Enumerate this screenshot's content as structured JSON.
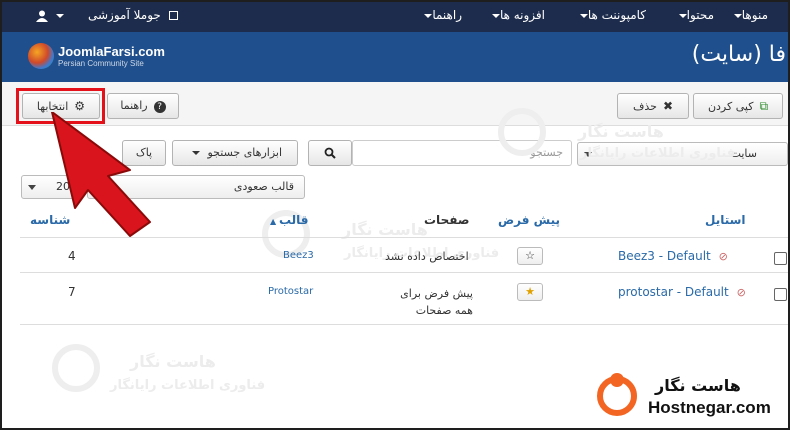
{
  "navbar": {
    "menus": [
      {
        "label": "منوها"
      },
      {
        "label": "محتوا"
      },
      {
        "label": "کامپوننت ها"
      },
      {
        "label": "افزونه ها"
      },
      {
        "label": "راهنما"
      }
    ],
    "site_label": "جوملا آموزشی"
  },
  "header": {
    "logo_text": "JoomlaFarsi.com",
    "logo_sub": "Persian Community Site",
    "title": "فا (سایت)"
  },
  "toolbar": {
    "copy_label": "کپی کردن",
    "delete_label": "حذف",
    "help_label": "راهنما",
    "options_label": "انتخابها"
  },
  "filters": {
    "site_select": "سایت",
    "search_placeholder": "جستجو",
    "search_tools_label": "ابزارهای جستجو",
    "clear_label": "پاک",
    "sort_select": "قالب صعودی",
    "limit_select": "20"
  },
  "table": {
    "headers": {
      "style": "استایل",
      "default": "پیش فرض",
      "pages": "صفحات",
      "template": "قالب",
      "id": "شناسه"
    },
    "rows": [
      {
        "style": "Beez3 - Default",
        "pages": "اختصاص داده نشد",
        "template": "Beez3",
        "id": "4",
        "default": false
      },
      {
        "style": "protostar - Default",
        "pages": "پیش فرض برای همه صفحات",
        "template": "Protostar",
        "id": "7",
        "default": true
      }
    ]
  },
  "watermark": {
    "name": "هاست نگار",
    "tagline": "فناوری اطلاعات رایانگار"
  },
  "brand": {
    "name": "هاست نگار",
    "url": "Hostnegar.com",
    "accent": "#f26522"
  },
  "colors": {
    "navbar": "#1d2c4c",
    "header": "#1f4f8c",
    "link": "#2a6aa8",
    "highlight": "#e4111b"
  }
}
